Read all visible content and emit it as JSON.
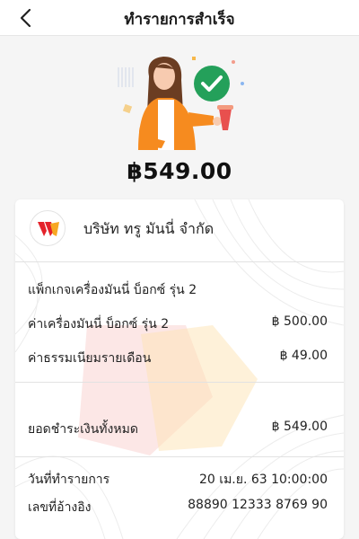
{
  "header": {
    "title": "ทำรายการสำเร็จ",
    "back_icon": "chevron-left-icon"
  },
  "hero": {
    "illustration_icon": "person-success-illustration",
    "check_color": "#24a05a",
    "amount": "฿549.00"
  },
  "merchant": {
    "name": "บริษัท ทรู มันนี่ จำกัด",
    "logo_icon": "truemoney-logo-icon",
    "logo_colors": [
      "#e4222a",
      "#f7a823"
    ]
  },
  "item": {
    "title": "แพ็กเกจเครื่องมันนี่ บ็อกซ์ รุ่น 2",
    "lines": [
      {
        "label": "ค่าเครื่องมันนี่ บ็อกซ์ รุ่น 2",
        "value": "฿ 500.00"
      },
      {
        "label": "ค่าธรรมเนียมรายเดือน",
        "value": "฿ 49.00"
      }
    ]
  },
  "total": {
    "label": "ยอดชำระเงินทั้งหมด",
    "value": "฿ 549.00"
  },
  "details": [
    {
      "label": "วันที่ทำรายการ",
      "value": "20 เม.ย. 63 10:00:00"
    },
    {
      "label": "เลขที่อ้างอิง",
      "value": "88890 12333 8769 90"
    }
  ],
  "colors": {
    "accent_orange": "#f68b1f",
    "background": "#f5f5f5"
  }
}
